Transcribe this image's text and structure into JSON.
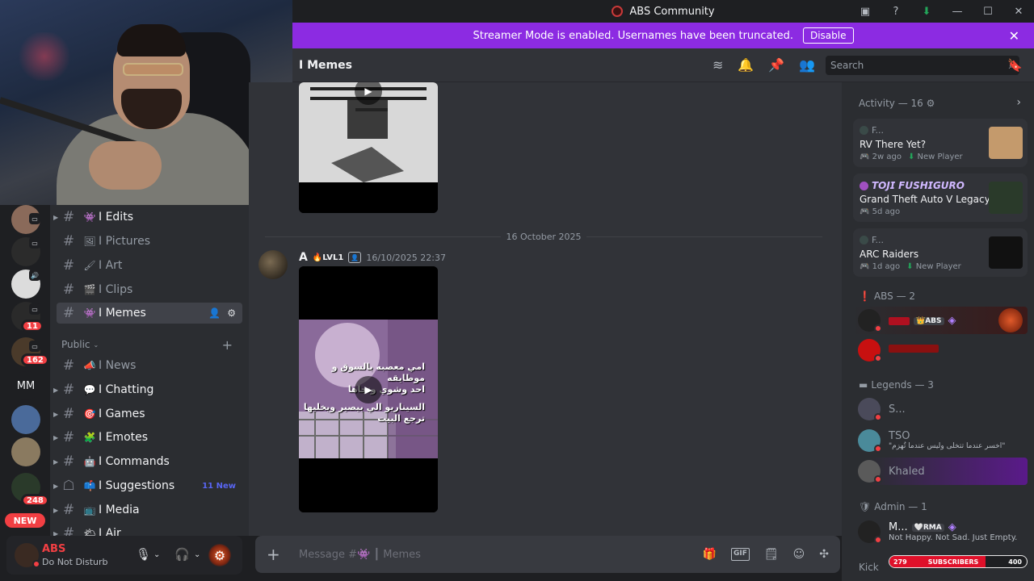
{
  "window": {
    "title": "ABS Community",
    "controls": [
      "minimize",
      "maximize",
      "close"
    ]
  },
  "banner": {
    "text": "Streamer Mode is enabled. Usernames have been truncated.",
    "button": "Disable"
  },
  "header": {
    "channel": "I Memes",
    "search_placeholder": "Search"
  },
  "servers": {
    "badges": [
      "11",
      "162",
      "248"
    ],
    "text_icon": "MM",
    "new_pill": "NEW"
  },
  "channels": {
    "upper": [
      {
        "emoji": "👾",
        "name": "I Edits",
        "unread": true,
        "caret": true
      },
      {
        "emoji": "🖼",
        "name": "I Pictures",
        "unread": false,
        "caret": false
      },
      {
        "emoji": "🖌",
        "name": "I Art",
        "unread": false,
        "caret": false
      },
      {
        "emoji": "🎬",
        "name": "I Clips",
        "unread": false,
        "caret": false
      },
      {
        "emoji": "👾",
        "name": "I Memes",
        "unread": true,
        "active": true
      }
    ],
    "category": "Public",
    "lower": [
      {
        "emoji": "📣",
        "name": "I News",
        "unread": false,
        "caret": false
      },
      {
        "emoji": "💬",
        "name": "I Chatting",
        "unread": true,
        "caret": true
      },
      {
        "emoji": "🎯",
        "name": "I Games",
        "unread": true,
        "caret": true
      },
      {
        "emoji": "🧩",
        "name": "I Emotes",
        "unread": true,
        "caret": true
      },
      {
        "emoji": "🤖",
        "name": "I Commands",
        "unread": true,
        "caret": true
      },
      {
        "emoji": "📫",
        "name": "I Suggestions",
        "unread": true,
        "caret": true,
        "new": "11 New"
      },
      {
        "emoji": "📺",
        "name": "I Media",
        "unread": true,
        "caret": true
      },
      {
        "emoji": "🌤",
        "name": "I Air",
        "unread": true,
        "caret": true
      }
    ]
  },
  "user": {
    "name": "ABS",
    "status": "Do Not Disturb"
  },
  "chat": {
    "date_divider": "16 October 2025",
    "message": {
      "author": "A",
      "level": "LVL1",
      "timestamp": "16/10/2025 22:37",
      "meme_lines": [
        "امي معصبه بالسوق و موطايقه",
        "احد وشوي وتجاها",
        "السيناريو الي بيصير ويخليها",
        "ترجع البيت"
      ]
    },
    "composer_placeholder": "Message #👾 ┃ Memes"
  },
  "activity": {
    "header": "Activity — 16",
    "cards": [
      {
        "user": "F...",
        "game": "RV There Yet?",
        "time": "2w ago",
        "status": "New Player",
        "thumb_color": "#c49a6c"
      },
      {
        "user": "𝙏𝙊𝙅𝙄 𝙁𝙐𝙎𝙃𝙄𝙂𝙐𝙍𝙊",
        "game": "Grand Theft Auto V Legacy",
        "time": "5d ago",
        "status": "",
        "thumb_color": "#2a3a2a"
      },
      {
        "user": "F...",
        "game": "ARC Raiders",
        "time": "1d ago",
        "status": "New Player",
        "thumb_color": "#111111"
      }
    ],
    "sections": [
      {
        "label": "ABS — 2",
        "members": [
          {
            "name": "",
            "tag": "👑ABS",
            "color": "#e0102a"
          },
          {
            "name": "",
            "tag": "",
            "color": "#c81010"
          }
        ]
      },
      {
        "label": "Legends — 3",
        "members": [
          {
            "name": "S...",
            "sub": ""
          },
          {
            "name": "TSO",
            "sub": "\"اخسر عندما تتخلى وليس عندما تُهزم\""
          },
          {
            "name": "Khaled",
            "sub": ""
          }
        ]
      },
      {
        "label": "Admin — 1",
        "members": [
          {
            "name": "M...",
            "tag": "🤍RMA",
            "sub": "Not Happy. Not Sad. Just Empty."
          }
        ]
      },
      {
        "label": "Kick"
      }
    ]
  },
  "subscribers": {
    "current": "279",
    "label": "SUBSCRIBERS",
    "goal": "400",
    "progress": 0.7
  },
  "colors": {
    "banner": "#8c2be2",
    "dnd": "#f23f43",
    "brand_red": "#e0102a"
  }
}
